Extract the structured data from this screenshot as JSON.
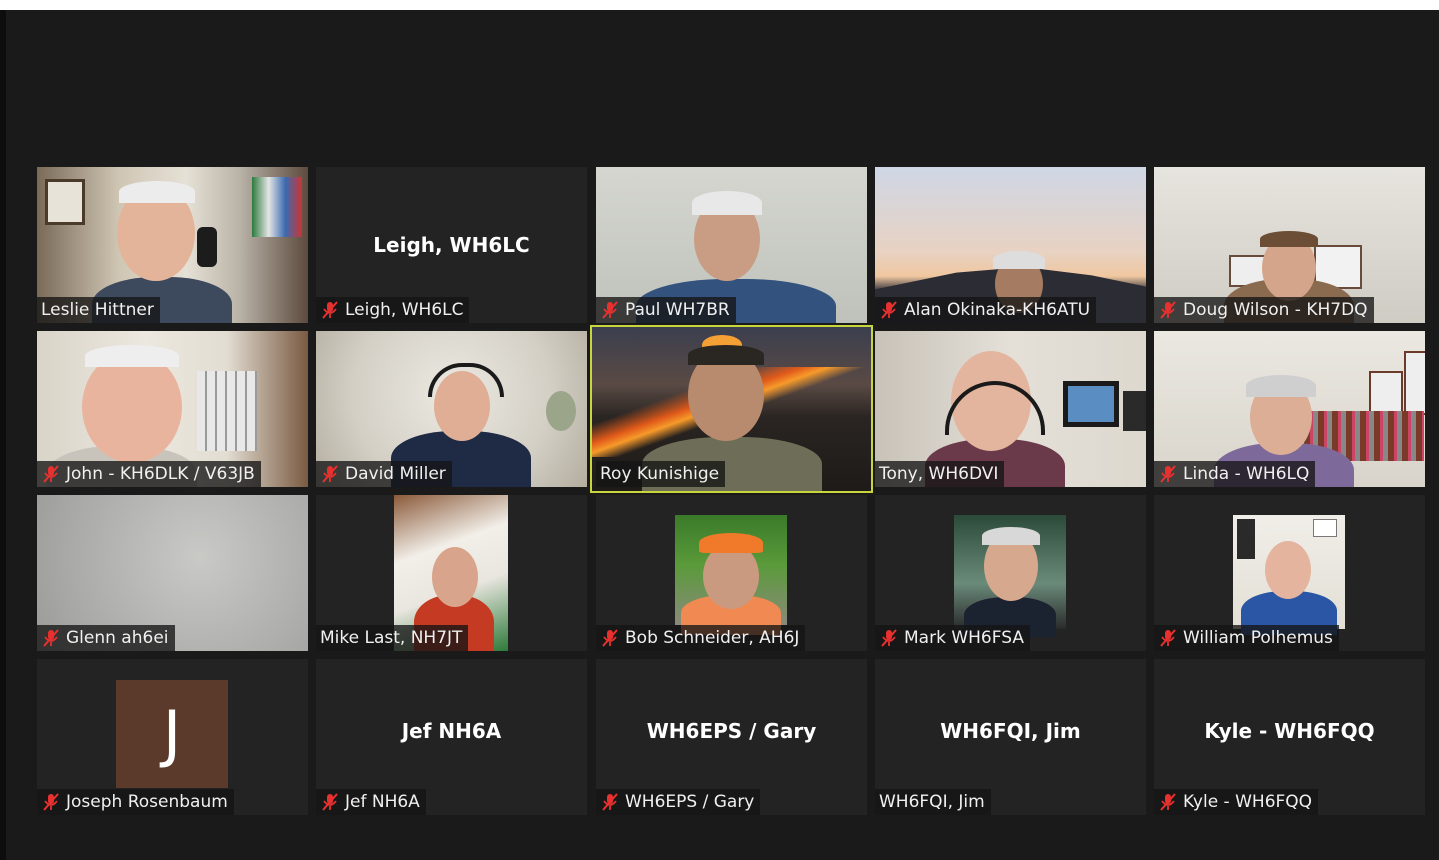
{
  "participants": [
    {
      "name": "Leslie Hittner",
      "muted": false
    },
    {
      "name": "Leigh, WH6LC",
      "muted": true,
      "video": false
    },
    {
      "name": "Paul WH7BR",
      "muted": true
    },
    {
      "name": "Alan Okinaka-KH6ATU",
      "muted": true
    },
    {
      "name": "Doug Wilson - KH7DQ",
      "muted": true
    },
    {
      "name": "John - KH6DLK / V63JB",
      "muted": true
    },
    {
      "name": "David Miller",
      "muted": true
    },
    {
      "name": "Roy Kunishige",
      "muted": false,
      "speaking": true
    },
    {
      "name": "Tony, WH6DVI",
      "muted": false
    },
    {
      "name": "Linda - WH6LQ",
      "muted": true
    },
    {
      "name": "Glenn ah6ei",
      "muted": true
    },
    {
      "name": "Mike Last, NH7JT",
      "muted": false
    },
    {
      "name": "Bob Schneider, AH6J",
      "muted": true
    },
    {
      "name": "Mark WH6FSA",
      "muted": true
    },
    {
      "name": "William Polhemus",
      "muted": true
    },
    {
      "name": "Joseph Rosenbaum",
      "muted": true,
      "avatar_letter": "J"
    },
    {
      "name": "Jef NH6A",
      "muted": true,
      "video": false
    },
    {
      "name": "WH6EPS / Gary",
      "muted": true,
      "video": false
    },
    {
      "name": "WH6FQI, Jim",
      "muted": false,
      "video": false
    },
    {
      "name": "Kyle - WH6FQQ",
      "muted": true,
      "video": false
    }
  ],
  "colors": {
    "muted_icon": "#e8312f",
    "active_speaker_border": "#c8d63c",
    "background": "#1a1a1a"
  },
  "icons": {
    "muted": "mic-muted-icon"
  }
}
